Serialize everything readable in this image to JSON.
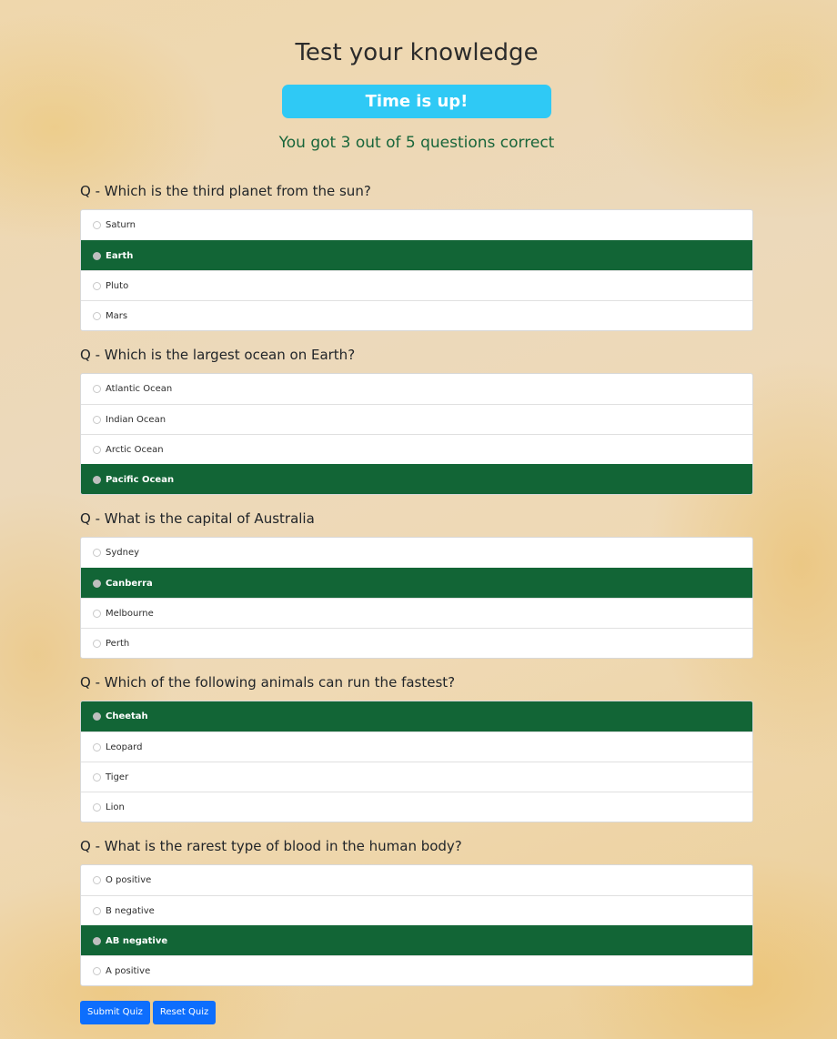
{
  "title": "Test your knowledge",
  "timer_label": "Time is up!",
  "score_text": "You got 3 out of 5 questions correct",
  "questions": [
    {
      "text": "Q - Which is the third planet from the sun?",
      "options": [
        "Saturn",
        "Earth",
        "Pluto",
        "Mars"
      ],
      "selected": 1
    },
    {
      "text": "Q - Which is the largest ocean on Earth?",
      "options": [
        "Atlantic Ocean",
        "Indian Ocean",
        "Arctic Ocean",
        "Pacific Ocean"
      ],
      "selected": 3
    },
    {
      "text": "Q - What is the capital of Australia",
      "options": [
        "Sydney",
        "Canberra",
        "Melbourne",
        "Perth"
      ],
      "selected": 1
    },
    {
      "text": "Q - Which of the following animals can run the fastest?",
      "options": [
        "Cheetah",
        "Leopard",
        "Tiger",
        "Lion"
      ],
      "selected": 0
    },
    {
      "text": "Q - What is the rarest type of blood in the human body?",
      "options": [
        "O positive",
        "B negative",
        "AB negative",
        "A positive"
      ],
      "selected": 2
    }
  ],
  "buttons": {
    "submit": "Submit Quiz",
    "reset": "Reset Quiz"
  },
  "colors": {
    "timer_bg": "#2fc9f5",
    "selected_bg": "#126536",
    "score_text": "#18653a",
    "button_bg": "#0d6efd"
  }
}
